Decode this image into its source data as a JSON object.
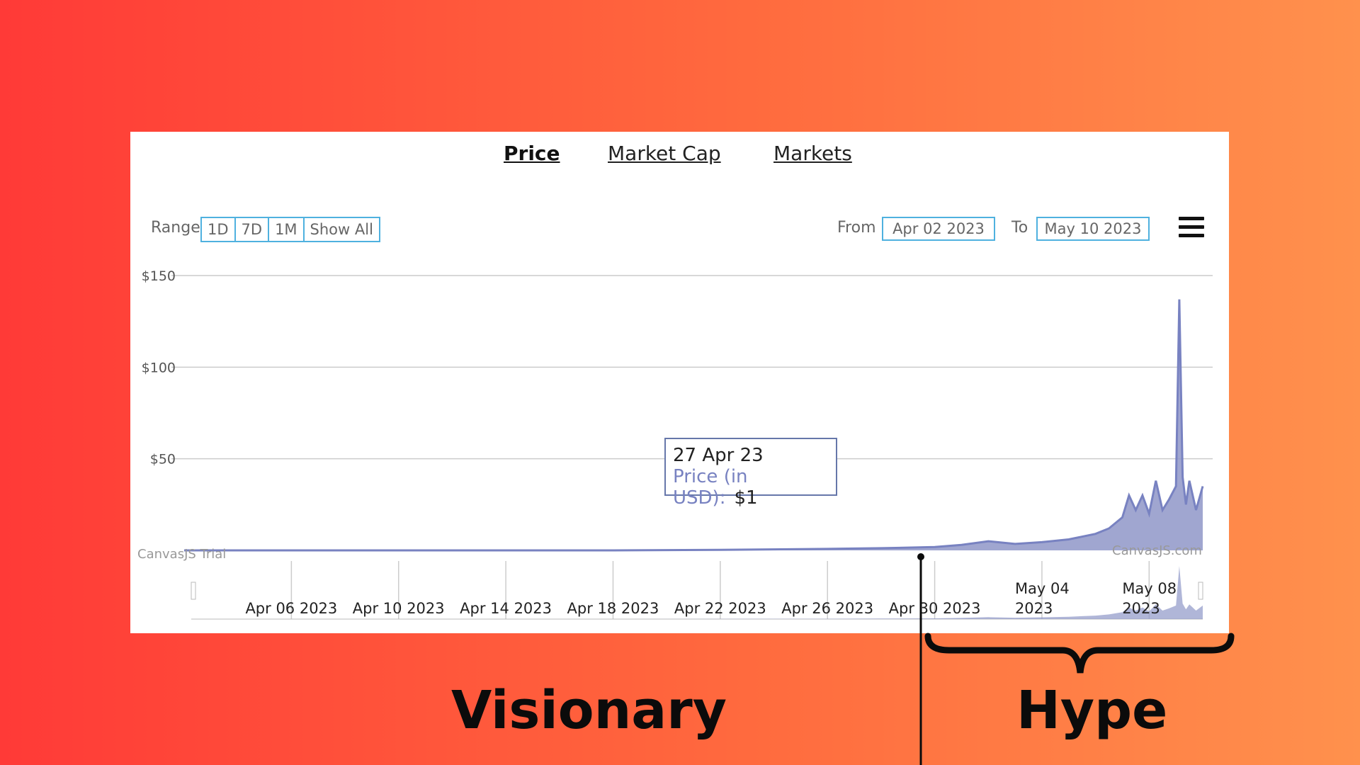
{
  "tabs": [
    {
      "label": "Price",
      "active": true
    },
    {
      "label": "Market Cap",
      "active": false
    },
    {
      "label": "Markets",
      "active": false
    }
  ],
  "range": {
    "label": "Range",
    "buttons": [
      "1D",
      "7D",
      "1M",
      "Show All"
    ]
  },
  "date_range": {
    "from_label": "From",
    "from_value": "Apr 02 2023",
    "to_label": "To",
    "to_value": "May 10 2023"
  },
  "tooltip": {
    "date": "27 Apr 23",
    "series": "Price (in USD):",
    "value": "$1"
  },
  "watermarks": {
    "left": "CanvasJS Trial",
    "right": "CanvasJS.com"
  },
  "annotations": {
    "left": "Visionary",
    "right": "Hype"
  },
  "colors": {
    "series": "#7882c1",
    "series_fill": "#8f97c8",
    "accent_border": "#4fb1df"
  },
  "icons": {
    "menu": "hamburger-menu-icon"
  },
  "chart_data": {
    "type": "area",
    "y_ticks": [
      "$150",
      "$100",
      "$50"
    ],
    "x_ticks": [
      "Apr 06 2023",
      "Apr 10 2023",
      "Apr 14 2023",
      "Apr 18 2023",
      "Apr 22 2023",
      "Apr 26 2023",
      "Apr 30 2023",
      "May 04 2023",
      "May 08 2023"
    ],
    "ylim": [
      0,
      150
    ],
    "xlim": [
      "2023-04-02",
      "2023-05-10"
    ],
    "series": [
      {
        "name": "Price (in USD)",
        "x": [
          "2023-04-02",
          "2023-04-06",
          "2023-04-10",
          "2023-04-14",
          "2023-04-18",
          "2023-04-22",
          "2023-04-26",
          "2023-04-28",
          "2023-04-30",
          "2023-05-01",
          "2023-05-02",
          "2023-05-03",
          "2023-05-04",
          "2023-05-05",
          "2023-05-06",
          "2023-05-06T12:00",
          "2023-05-07",
          "2023-05-07T06:00",
          "2023-05-07T12:00",
          "2023-05-07T18:00",
          "2023-05-08",
          "2023-05-08T06:00",
          "2023-05-08T12:00",
          "2023-05-08T18:00",
          "2023-05-09",
          "2023-05-09T03:00",
          "2023-05-09T06:00",
          "2023-05-09T09:00",
          "2023-05-09T12:00",
          "2023-05-09T18:00",
          "2023-05-10"
        ],
        "y": [
          0,
          0,
          0,
          0,
          0,
          0.3,
          0.8,
          1.2,
          1.8,
          3,
          5,
          3.5,
          4.5,
          6,
          9,
          12,
          18,
          30,
          22,
          30,
          20,
          38,
          22,
          28,
          35,
          137,
          40,
          25,
          38,
          22,
          35
        ]
      }
    ],
    "grid": true,
    "tooltip_point": {
      "date": "27 Apr 23",
      "value": 1
    }
  }
}
